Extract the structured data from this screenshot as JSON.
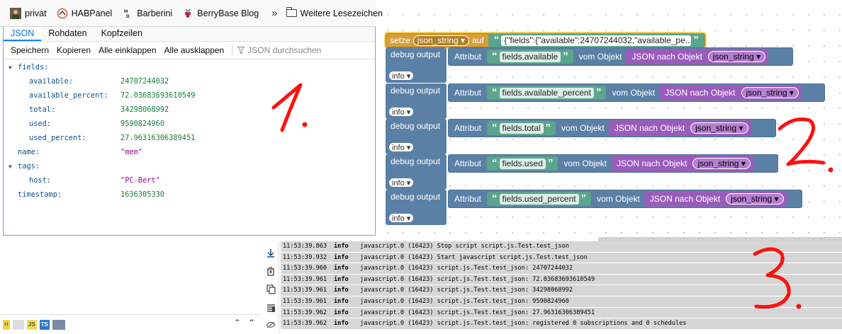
{
  "bookmarks": {
    "items": [
      {
        "label": "privat",
        "icon": "avatar-photo"
      },
      {
        "label": "HABPanel",
        "icon": "habpanel-icon"
      },
      {
        "label": "Barberini",
        "icon": "mb-icon"
      },
      {
        "label": "BerryBase Blog",
        "icon": "raspberry-icon"
      }
    ],
    "overflow": "»",
    "folder_label": "Weitere Lesezeichen"
  },
  "json_viewer": {
    "tabs": [
      "JSON",
      "Rohdaten",
      "Kopfzeilen"
    ],
    "active_tab": "JSON",
    "actions": [
      "Speichern",
      "Kopieren",
      "Alle einklappen",
      "Alle ausklappen"
    ],
    "filter_placeholder": "JSON durchsuchen",
    "tree": {
      "fields_key": "fields:",
      "fields": [
        {
          "key": "available:",
          "value": "24707244032"
        },
        {
          "key": "available_percent:",
          "value": "72.03683693610549"
        },
        {
          "key": "total:",
          "value": "34298068992"
        },
        {
          "key": "used:",
          "value": "9590824960"
        },
        {
          "key": "used_percent:",
          "value": "27.96316306389451"
        }
      ],
      "name_key": "name:",
      "name_value": "\"mem\"",
      "tags_key": "tags:",
      "host_key": "host:",
      "host_value": "\"PC-Bert\"",
      "timestamp_key": "timestamp:",
      "timestamp_value": "1636305330"
    }
  },
  "blockly": {
    "set_label": "setze",
    "set_var": "json_string",
    "set_to": "auf",
    "set_string": "{\"fields\":{\"available\":24707244032,\"available_pe...",
    "quote_open": "“",
    "quote_close": "”",
    "debug_label": "debug output",
    "info_label": "info",
    "attr_label": "Attribut",
    "from_object_label": "vom Objekt",
    "json_label": "JSON nach Objekt",
    "var_label": "json_string",
    "attributes": [
      "fields.available",
      "fields.available_percent",
      "fields.total",
      "fields.used",
      "fields.used_percent"
    ]
  },
  "log": {
    "rows": [
      {
        "time": "11:53:39.863",
        "sev": "info",
        "msg": "javascript.0 (16423) Stop script script.js.Test.test_json"
      },
      {
        "time": "11:53:39.932",
        "sev": "info",
        "msg": "javascript.0 (16423) Start javascript script.js.Test.test_json"
      },
      {
        "time": "11:53:39.960",
        "sev": "info",
        "msg": "javascript.0 (16423) script.js.Test.test_json: 24707244032"
      },
      {
        "time": "11:53:39.961",
        "sev": "info",
        "msg": "javascript.0 (16423) script.js.Test.test_json: 72.03683693610549"
      },
      {
        "time": "11:53:39.961",
        "sev": "info",
        "msg": "javascript.0 (16423) script.js.Test.test_json: 34298068992"
      },
      {
        "time": "11:53:39.961",
        "sev": "info",
        "msg": "javascript.0 (16423) script.js.Test.test_json: 9590824960"
      },
      {
        "time": "11:53:39.962",
        "sev": "info",
        "msg": "javascript.0 (16423) script.js.Test.test_json: 27.96316306389451"
      },
      {
        "time": "11:53:39.962",
        "sev": "info",
        "msg": "javascript.0 (16423) script.js.Test.test_json: registered 0 subscriptions and 0 schedules"
      }
    ]
  },
  "bottom_bar": {
    "badges": [
      "JS",
      "TS"
    ]
  },
  "annotations": [
    "1.",
    "2.",
    "3."
  ],
  "colors": {
    "accent_blue": "#0a84ff",
    "block_blue": "#5b80a5",
    "block_green": "#5ba58c",
    "block_purple": "#9a5cbb",
    "block_orange": "#d69f3a",
    "annotation_red": "#ff1010"
  }
}
